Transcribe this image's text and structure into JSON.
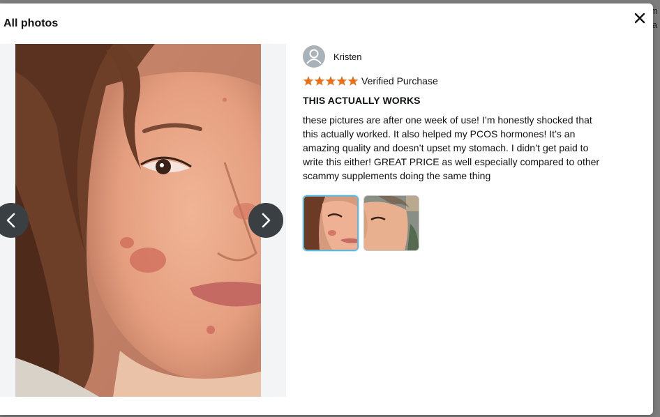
{
  "modal": {
    "title": "All photos"
  },
  "gallery": {
    "main_photo": "face-photo-1",
    "prev_icon": "chevron-left-icon",
    "next_icon": "chevron-right-icon"
  },
  "review": {
    "reviewer_name": "Kristen",
    "rating_stars": 5,
    "rating_max": 5,
    "verified_label": "Verified Purchase",
    "title": "THIS ACTUALLY WORKS",
    "body": "these pictures are after one week of use! I’m honestly shocked that this actually worked. It also helped my PCOS hormones! It’s an amazing quality and doesn’t upset my stomach. I didn’t get paid to write this either! GREAT PRICE as well especially compared to other scammy supplements doing the same thing",
    "thumbnails": [
      {
        "name": "thumbnail-1",
        "active": true
      },
      {
        "name": "thumbnail-2",
        "active": false
      }
    ]
  },
  "colors": {
    "star": "#e7711b",
    "nav_button": "#3a3f43",
    "thumb_active_border": "#64b6d3"
  },
  "background_page": {
    "edge_text": [
      "m",
      "la"
    ]
  }
}
